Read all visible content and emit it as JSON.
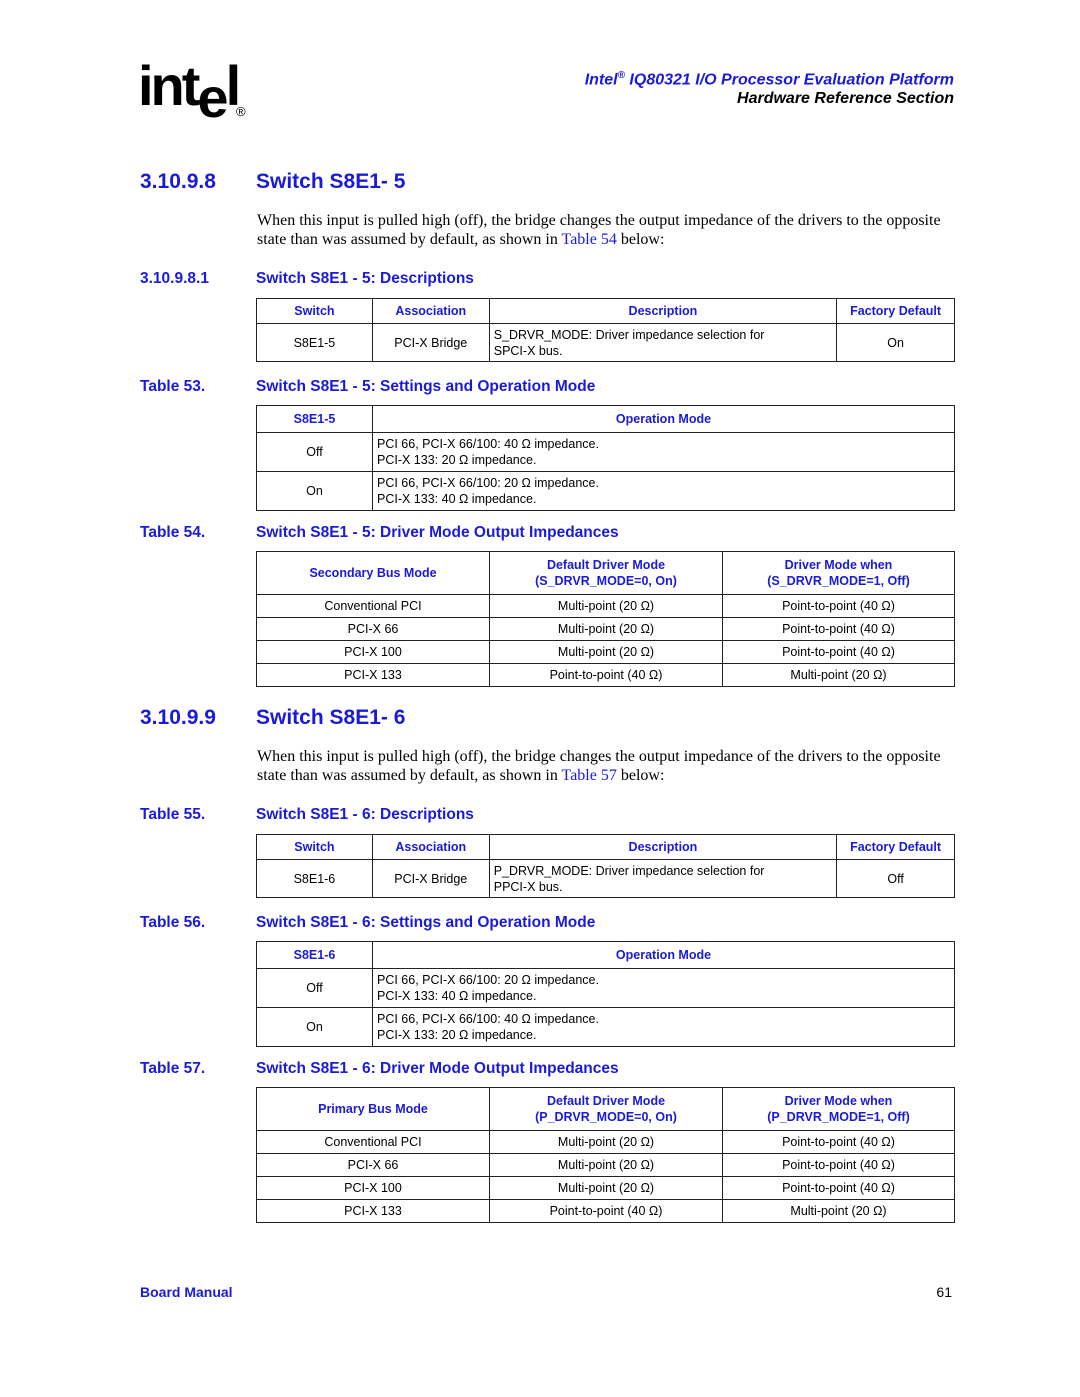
{
  "header": {
    "logo_text": "intel",
    "logo_reg": "®",
    "title_prefix": "Intel",
    "title_reg": "®",
    "title_rest": " IQ80321 I/O Processor Evaluation Platform",
    "subtitle": "Hardware Reference Section"
  },
  "section_1": {
    "number": "3.10.9.8",
    "title": "Switch S8E1- 5",
    "para_before": "When this input is pulled high (off), the bridge changes the output impedance of the drivers to the opposite state than was assumed by default, as shown in ",
    "para_link": "Table 54",
    "para_after": " below:",
    "sub_number": "3.10.9.8.1",
    "sub_title": "Switch S8E1 - 5: Descriptions",
    "desc_table": {
      "headers": [
        "Switch",
        "Association",
        "Description",
        "Factory Default"
      ],
      "row": [
        "S8E1-5",
        "PCI-X Bridge",
        "S_DRVR_MODE: Driver impedance selection for",
        "SPCI-X bus.",
        "On"
      ]
    },
    "table53": {
      "caption_num": "Table 53.",
      "caption_title": "Switch S8E1 - 5: Settings and Operation Mode",
      "headers": [
        "S8E1-5",
        "Operation Mode"
      ],
      "rows": [
        {
          "state": "Off",
          "line1": "PCI 66, PCI-X 66/100: 40 Ω impedance.",
          "line2": "PCI-X 133: 20 Ω impedance."
        },
        {
          "state": "On",
          "line1": "PCI 66, PCI-X 66/100: 20 Ω impedance.",
          "line2": "PCI-X 133: 40 Ω impedance."
        }
      ]
    },
    "table54": {
      "caption_num": "Table 54.",
      "caption_title": "Switch S8E1 - 5: Driver Mode Output Impedances",
      "headers": [
        "Secondary Bus Mode",
        "Default Driver Mode",
        "(S_DRVR_MODE=0, On)",
        "Driver Mode when",
        "(S_DRVR_MODE=1, Off)"
      ],
      "rows": [
        [
          "Conventional PCI",
          "Multi-point (20 Ω)",
          "Point-to-point (40 Ω)"
        ],
        [
          "PCI-X 66",
          "Multi-point (20 Ω)",
          "Point-to-point (40 Ω)"
        ],
        [
          "PCI-X 100",
          "Multi-point (20 Ω)",
          "Point-to-point (40 Ω)"
        ],
        [
          "PCI-X 133",
          "Point-to-point (40 Ω)",
          "Multi-point (20 Ω)"
        ]
      ]
    }
  },
  "section_2": {
    "number": "3.10.9.9",
    "title": "Switch S8E1- 6",
    "para_before": "When this input is pulled high (off), the bridge changes the output impedance of the drivers to the opposite state than was assumed by default, as shown in ",
    "para_link": "Table 57",
    "para_after": " below:",
    "table55": {
      "caption_num": "Table 55.",
      "caption_title": "Switch S8E1 - 6: Descriptions",
      "headers": [
        "Switch",
        "Association",
        "Description",
        "Factory Default"
      ],
      "row": [
        "S8E1-6",
        "PCI-X Bridge",
        "P_DRVR_MODE: Driver impedance selection for",
        "PPCI-X bus.",
        "Off"
      ]
    },
    "table56": {
      "caption_num": "Table 56.",
      "caption_title": "Switch S8E1 - 6: Settings and Operation Mode",
      "headers": [
        "S8E1-6",
        "Operation Mode"
      ],
      "rows": [
        {
          "state": "Off",
          "line1": "PCI 66, PCI-X 66/100: 20 Ω impedance.",
          "line2": "PCI-X 133: 40 Ω impedance."
        },
        {
          "state": "On",
          "line1": "PCI 66, PCI-X 66/100: 40 Ω impedance.",
          "line2": "PCI-X 133: 20 Ω impedance."
        }
      ]
    },
    "table57": {
      "caption_num": "Table 57.",
      "caption_title": "Switch S8E1 - 6: Driver Mode Output Impedances",
      "headers": [
        "Primary Bus Mode",
        "Default Driver Mode",
        "(P_DRVR_MODE=0, On)",
        "Driver Mode when",
        "(P_DRVR_MODE=1, Off)"
      ],
      "rows": [
        [
          "Conventional PCI",
          "Multi-point (20 Ω)",
          "Point-to-point (40 Ω)"
        ],
        [
          "PCI-X 66",
          "Multi-point (20 Ω)",
          "Point-to-point (40 Ω)"
        ],
        [
          "PCI-X 100",
          "Multi-point (20 Ω)",
          "Point-to-point (40 Ω)"
        ],
        [
          "PCI-X 133",
          "Point-to-point (40 Ω)",
          "Multi-point (20 Ω)"
        ]
      ]
    }
  },
  "footer": {
    "left": "Board Manual",
    "page_number": "61"
  }
}
